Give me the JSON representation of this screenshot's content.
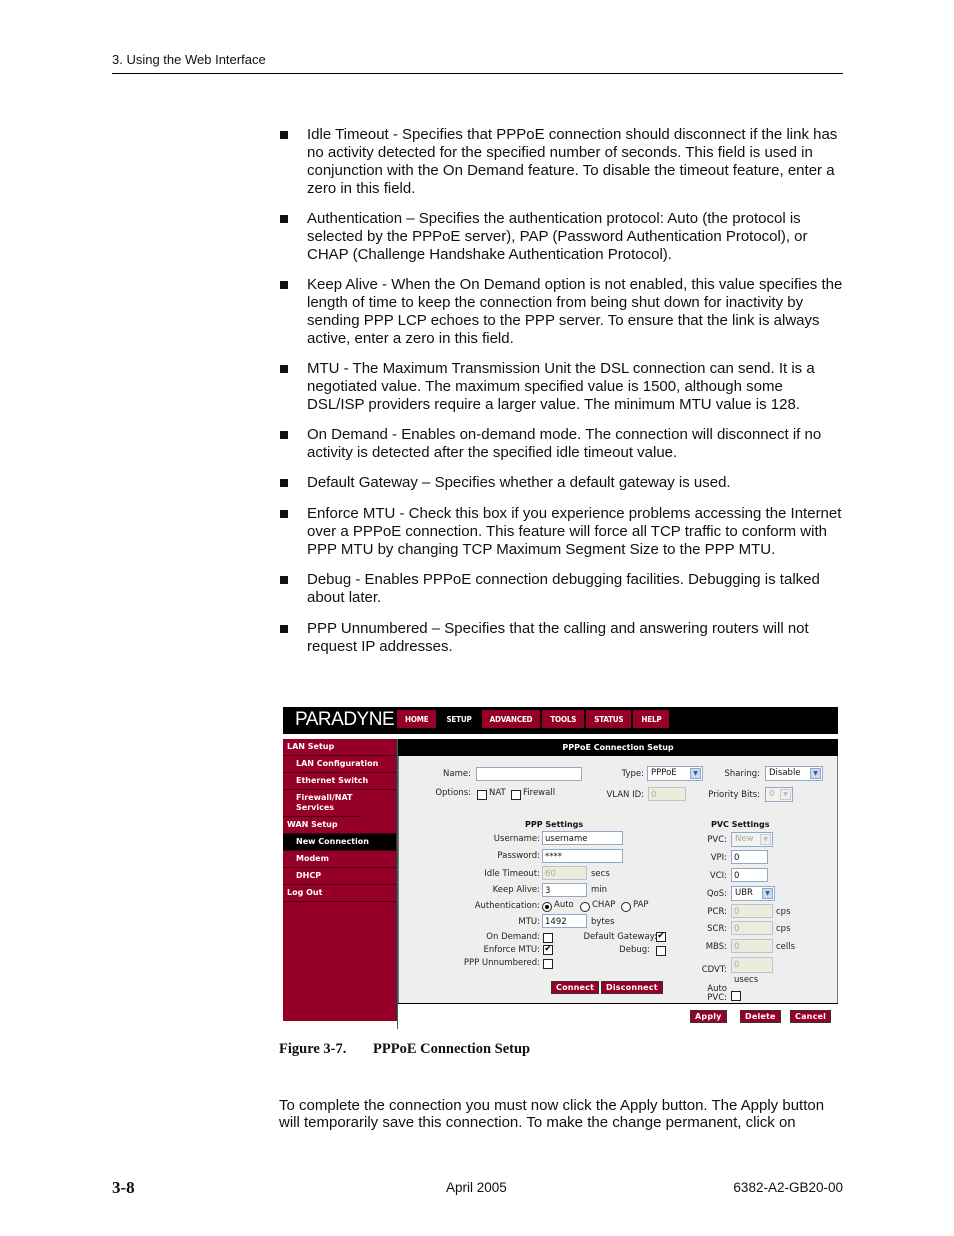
{
  "header": {
    "running_title": "3. Using the Web Interface"
  },
  "bullets": [
    "Idle Timeout - Specifies that PPPoE connection should disconnect if the link has no activity detected for the specified number of seconds. This field is used in conjunction with the On Demand feature. To disable the timeout feature, enter a zero in this field.",
    "Authentication – Specifies the authentication protocol: Auto (the protocol is selected by the PPPoE server), PAP (Password Authentication Protocol), or CHAP (Challenge Handshake Authentication Protocol).",
    "Keep Alive - When the On Demand option is not enabled, this value specifies the length of time to keep the connection from being shut down for inactivity by sending PPP LCP echoes to the PPP server. To ensure that the link is always active, enter a zero in this field.",
    "MTU - The Maximum Transmission Unit the DSL connection can send. It is a negotiated value. The maximum specified value is 1500, although some DSL/ISP providers require a larger value. The minimum MTU value is 128.",
    "On Demand - Enables on-demand mode. The connection will disconnect if no activity is detected after the specified idle timeout value.",
    "Default Gateway – Specifies whether a default gateway is used.",
    "Enforce MTU - Check this box if you experience problems accessing the Internet over a PPPoE connection. This feature will force all TCP traffic to conform with PPP MTU by changing TCP Maximum Segment Size to the PPP MTU.",
    "Debug - Enables PPPoE connection debugging facilities.  Debugging is talked about later.",
    "PPP Unnumbered – Specifies that the calling and answering routers will not request IP addresses."
  ],
  "figure": {
    "logo": "PARADYNE",
    "colors": {
      "brand": "#960028",
      "bar": "#000000",
      "panel": "#eeeeee"
    },
    "nav": [
      "HOME",
      "SETUP",
      "ADVANCED",
      "TOOLS",
      "STATUS",
      "HELP"
    ],
    "nav_active": "SETUP",
    "sidebar": [
      {
        "label": "LAN Setup",
        "level": 0
      },
      {
        "label": "LAN Configuration",
        "level": 1
      },
      {
        "label": "Ethernet Switch",
        "level": 1
      },
      {
        "label": "Firewall/NAT Services",
        "level": 1
      },
      {
        "label": "WAN Setup",
        "level": 0
      },
      {
        "label": "New Connection",
        "level": 1,
        "selected": true
      },
      {
        "label": "Modem",
        "level": 1
      },
      {
        "label": "DHCP",
        "level": 1
      },
      {
        "label": "Log Out",
        "level": 0
      }
    ],
    "page_title": "PPPoE Connection Setup",
    "form": {
      "name_label": "Name:",
      "name_value": "",
      "type_label": "Type:",
      "type_value": "PPPoE",
      "sharing_label": "Sharing:",
      "sharing_value": "Disable",
      "options_label": "Options:",
      "nat_label": "NAT",
      "firewall_label": "Firewall",
      "vlan_label": "VLAN ID:",
      "vlan_value": "0",
      "priority_label": "Priority Bits:",
      "priority_value": "0",
      "ppp_heading": "PPP Settings",
      "username_label": "Username:",
      "username_value": "username",
      "password_label": "Password:",
      "password_value": "****",
      "idle_label": "Idle Timeout:",
      "idle_value": "60",
      "idle_unit": "secs",
      "keepalive_label": "Keep Alive:",
      "keepalive_value": "3",
      "keepalive_unit": "min",
      "auth_label": "Authentication:",
      "auth_options": [
        "Auto",
        "CHAP",
        "PAP"
      ],
      "auth_selected": "Auto",
      "mtu_label": "MTU:",
      "mtu_value": "1492",
      "mtu_unit": "bytes",
      "ondemand_label": "On Demand:",
      "ondemand_checked": false,
      "defgw_label": "Default Gateway:",
      "defgw_checked": true,
      "enforce_label": "Enforce MTU:",
      "enforce_checked": true,
      "debug_label": "Debug:",
      "debug_checked": false,
      "unnumbered_label": "PPP Unnumbered:",
      "unnumbered_checked": false,
      "connect_label": "Connect",
      "disconnect_label": "Disconnect",
      "pvc_heading": "PVC Settings",
      "pvc_label": "PVC:",
      "pvc_value": "New",
      "vpi_label": "VPI:",
      "vpi_value": "0",
      "vci_label": "VCI:",
      "vci_value": "0",
      "qos_label": "QoS:",
      "qos_value": "UBR",
      "pcr_label": "PCR:",
      "pcr_value": "0",
      "pcr_unit": "cps",
      "scr_label": "SCR:",
      "scr_value": "0",
      "scr_unit": "cps",
      "mbs_label": "MBS:",
      "mbs_value": "0",
      "mbs_unit": "cells",
      "cdvt_label": "CDVT:",
      "cdvt_value": "0",
      "cdvt_unit": "usecs",
      "autopvc_label_1": "Auto",
      "autopvc_label_2": "PVC:",
      "autopvc_checked": false
    },
    "footer_buttons": [
      "Apply",
      "Delete",
      "Cancel"
    ],
    "caption_number": "Figure 3-7.",
    "caption_title": "PPPoE Connection Setup"
  },
  "closing_paragraph": "To complete the connection you must now click the Apply button. The Apply button will temporarily save this connection. To make the change permanent, click on",
  "footer": {
    "page_number": "3-8",
    "date": "April 2005",
    "doc_id": "6382-A2-GB20-00"
  }
}
